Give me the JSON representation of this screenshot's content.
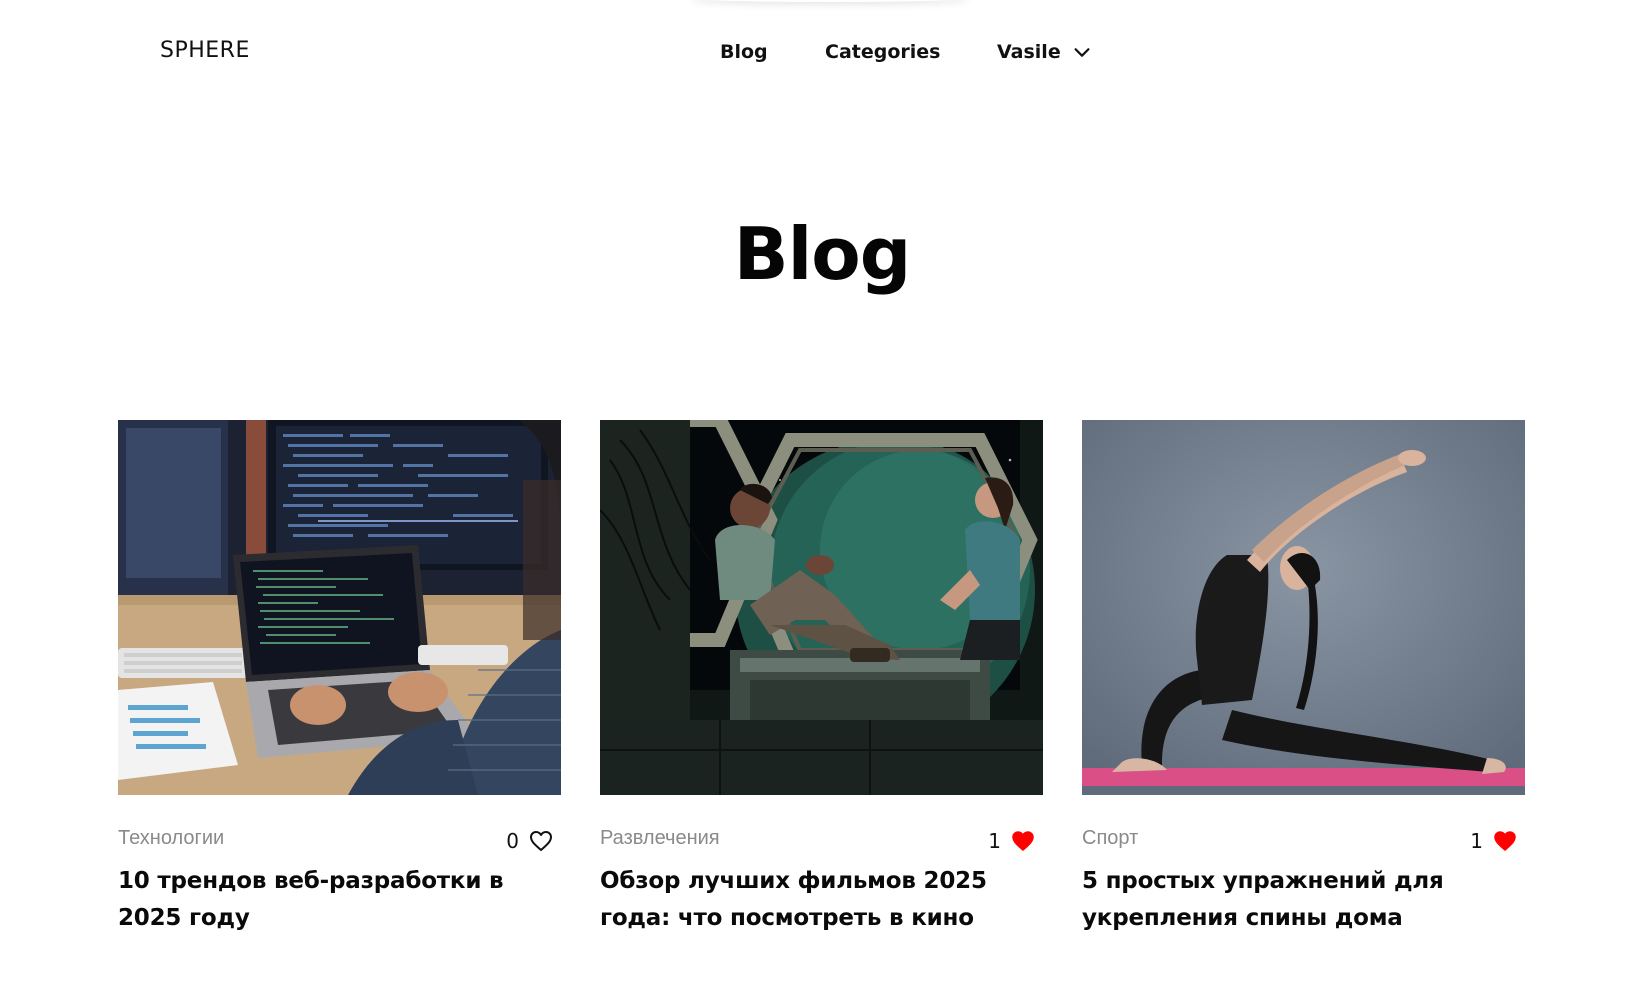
{
  "header": {
    "logo": "SPHERE",
    "nav": {
      "blog": "Blog",
      "categories": "Categories",
      "user": "Vasile"
    }
  },
  "page": {
    "title": "Blog"
  },
  "posts": [
    {
      "category": "Технологии",
      "likes": "0",
      "liked": false,
      "title": "10 трендов веб-разработки в 2025 году",
      "image": "developer-coding-laptop"
    },
    {
      "category": "Развлечения",
      "likes": "1",
      "liked": true,
      "title": "Обзор лучших фильмов 2025 года: что посмотреть в кино",
      "image": "spaceship-window-scene"
    },
    {
      "category": "Спорт",
      "likes": "1",
      "liked": true,
      "title": "5 простых упражнений для укрепления спины дома",
      "image": "yoga-stretch-pose"
    }
  ],
  "colors": {
    "heart_liked": "#ff0000",
    "category_text": "#8a8a8a",
    "text": "#111111"
  }
}
